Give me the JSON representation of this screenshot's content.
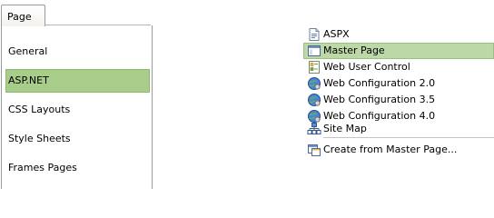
{
  "left_panel": {
    "tab_label": "Page",
    "categories": [
      {
        "label": "General",
        "selected": false
      },
      {
        "label": "ASP.NET",
        "selected": true
      },
      {
        "label": "CSS Layouts",
        "selected": false
      },
      {
        "label": "Style Sheets",
        "selected": false
      },
      {
        "label": "Frames Pages",
        "selected": false
      }
    ]
  },
  "menu": {
    "items": [
      {
        "label": "ASPX",
        "icon": "aspx-page-icon"
      },
      {
        "label": "Master Page",
        "icon": "master-page-icon",
        "highlighted": true
      },
      {
        "label": "Web User Control",
        "icon": "user-control-icon"
      },
      {
        "label": "Web Configuration 2.0",
        "icon": "web-config-icon"
      },
      {
        "label": "Web Configuration 3.5",
        "icon": "web-config-icon"
      },
      {
        "label": "Web Configuration 4.0",
        "icon": "web-config-icon"
      },
      {
        "label": "Site Map",
        "icon": "sitemap-icon"
      }
    ],
    "footer_item": {
      "label": "Create from Master Page...",
      "icon": "create-from-master-icon"
    }
  },
  "colors": {
    "selection_green": "#a8cc8a",
    "menu_highlight": "#bcd8a7"
  }
}
